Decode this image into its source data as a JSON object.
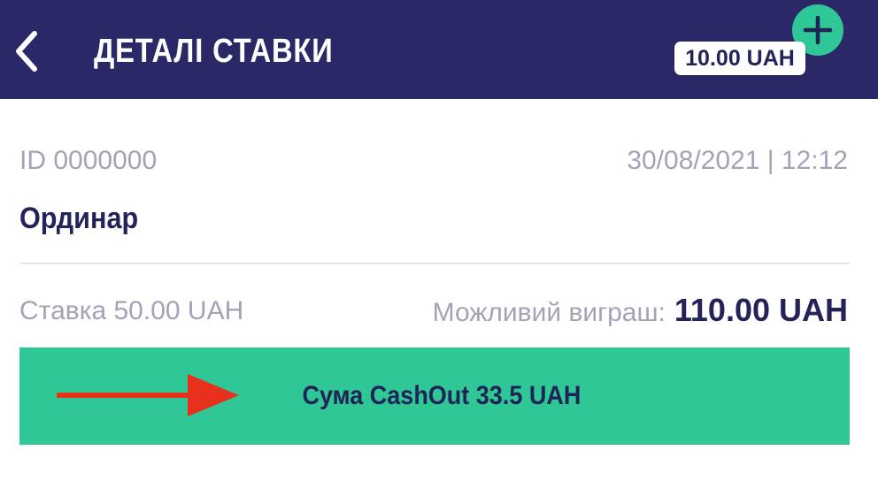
{
  "header": {
    "title": "ДЕТАЛІ СТАВКИ",
    "back_icon": "chevron-left-icon",
    "add_icon": "plus-icon",
    "balance": "10.00 UAH"
  },
  "bet": {
    "id": "ID 0000000",
    "datetime": "30/08/2021 | 12:12",
    "type": "Ординар",
    "stake": "Ставка 50.00 UAH",
    "potential_win_label": "Можливий виграш:",
    "potential_win_value": "110.00 UAH"
  },
  "cashout": {
    "label": "Сума CashOut 33.5 UAH"
  },
  "colors": {
    "header_bg": "#2a2866",
    "accent_green": "#2fc795",
    "text_dark": "#23235a",
    "text_muted": "#a3a3b8",
    "arrow": "#e8311d"
  }
}
